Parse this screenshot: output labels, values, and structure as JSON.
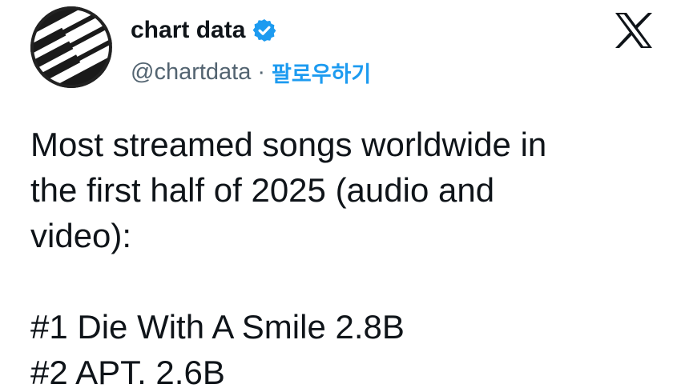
{
  "author": {
    "display_name": "chart data",
    "handle": "@chartdata",
    "separator": "·",
    "follow_label": "팔로우하기",
    "verified_color": "#1d9bf0",
    "avatar_icon": "piano-keys-avatar"
  },
  "header": {
    "brand_icon": "x-logo-icon"
  },
  "tweet": {
    "intro_lines": [
      "Most streamed songs worldwide in",
      "the first half of 2025 (audio and",
      "video):"
    ],
    "entries": [
      "#1 Die With A Smile 2.8B",
      "#2 APT. 2.6B"
    ]
  },
  "colors": {
    "text": "#0f1419",
    "secondary": "#536471",
    "accent": "#1d9bf0"
  }
}
